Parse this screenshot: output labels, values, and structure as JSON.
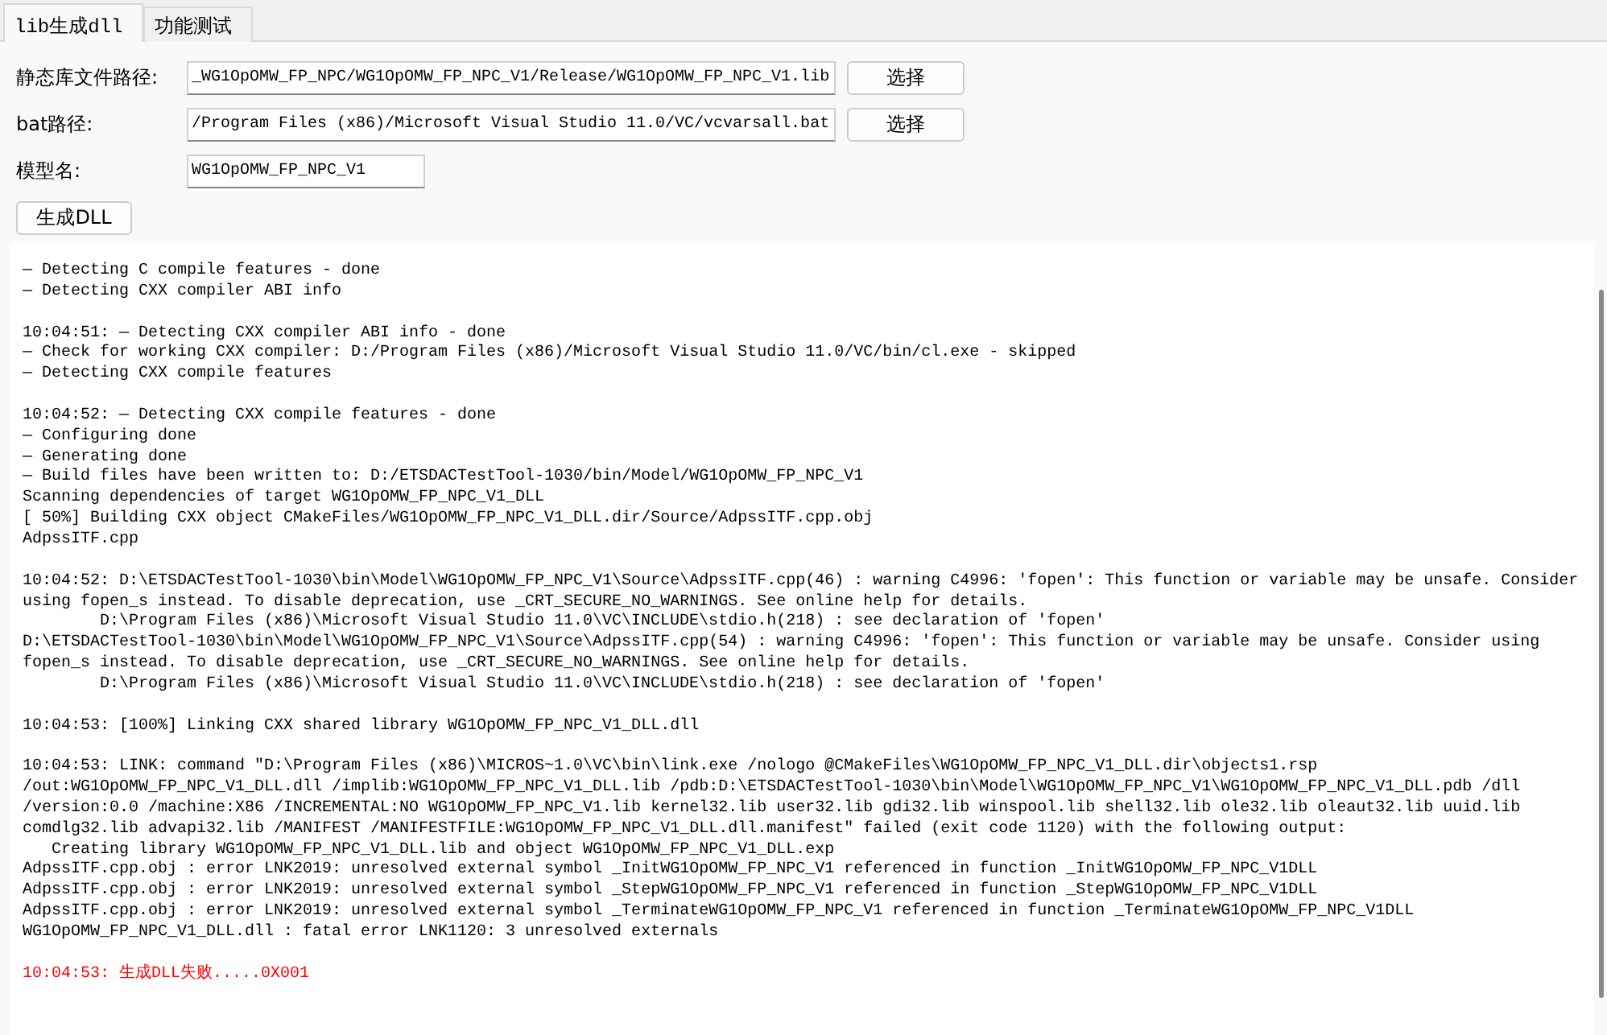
{
  "tabs": [
    {
      "label": "lib生成dll",
      "selected": true
    },
    {
      "label": "功能测试",
      "selected": false
    }
  ],
  "form": [
    {
      "label": "静态库文件路径:",
      "value": "_WG1OpOMW_FP_NPC/WG1OpOMW_FP_NPC_V1/Release/WG1OpOMW_FP_NPC_V1.lib",
      "button": "选择"
    },
    {
      "label": "bat路径:",
      "value": "/Program Files (x86)/Microsoft Visual Studio 11.0/VC/vcvarsall.bat",
      "button": "选择"
    },
    {
      "label": "模型名:",
      "value": "WG1OpOMW_FP_NPC_V1"
    }
  ],
  "generate_button": "生成DLL",
  "log": [
    {
      "kind": "plain",
      "text": "— Detecting C compile features - done"
    },
    {
      "kind": "plain",
      "text": "— Detecting CXX compiler ABI info"
    },
    {
      "kind": "blank"
    },
    {
      "kind": "plain",
      "text": "10:04:51: — Detecting CXX compiler ABI info - done"
    },
    {
      "kind": "plain",
      "text": "— Check for working CXX compiler: D:/Program Files (x86)/Microsoft Visual Studio 11.0/VC/bin/cl.exe - skipped"
    },
    {
      "kind": "plain",
      "text": "— Detecting CXX compile features"
    },
    {
      "kind": "blank"
    },
    {
      "kind": "plain",
      "text": "10:04:52: — Detecting CXX compile features - done"
    },
    {
      "kind": "plain",
      "text": "— Configuring done"
    },
    {
      "kind": "plain",
      "text": "— Generating done"
    },
    {
      "kind": "plain",
      "text": "— Build files have been written to: D:/ETSDACTestTool-1030/bin/Model/WG1OpOMW_FP_NPC_V1"
    },
    {
      "kind": "plain",
      "text": "Scanning dependencies of target WG1OpOMW_FP_NPC_V1_DLL"
    },
    {
      "kind": "plain",
      "text": "[ 50%] Building CXX object CMakeFiles/WG1OpOMW_FP_NPC_V1_DLL.dir/Source/AdpssITF.cpp.obj"
    },
    {
      "kind": "plain",
      "text": "AdpssITF.cpp"
    },
    {
      "kind": "blank"
    },
    {
      "kind": "plain",
      "text": "10:04:52: D:\\ETSDACTestTool-1030\\bin\\Model\\WG1OpOMW_FP_NPC_V1\\Source\\AdpssITF.cpp(46) : warning C4996: 'fopen': This function or variable may be unsafe. Consider"
    },
    {
      "kind": "plain",
      "text": "using fopen_s instead. To disable deprecation, use _CRT_SECURE_NO_WARNINGS. See online help for details."
    },
    {
      "kind": "tab",
      "text": "D:\\Program Files (x86)\\Microsoft Visual Studio 11.0\\VC\\INCLUDE\\stdio.h(218) : see declaration of 'fopen'"
    },
    {
      "kind": "plain",
      "text": "D:\\ETSDACTestTool-1030\\bin\\Model\\WG1OpOMW_FP_NPC_V1\\Source\\AdpssITF.cpp(54) : warning C4996: 'fopen': This function or variable may be unsafe. Consider using"
    },
    {
      "kind": "plain",
      "text": "fopen_s instead. To disable deprecation, use _CRT_SECURE_NO_WARNINGS. See online help for details."
    },
    {
      "kind": "tab",
      "text": "D:\\Program Files (x86)\\Microsoft Visual Studio 11.0\\VC\\INCLUDE\\stdio.h(218) : see declaration of 'fopen'"
    },
    {
      "kind": "blank"
    },
    {
      "kind": "plain",
      "text": "10:04:53: [100%] Linking CXX shared library WG1OpOMW_FP_NPC_V1_DLL.dll"
    },
    {
      "kind": "blank"
    },
    {
      "kind": "plain",
      "text": "10:04:53: LINK: command \"D:\\Program Files (x86)\\MICROS~1.0\\VC\\bin\\link.exe /nologo @CMakeFiles\\WG1OpOMW_FP_NPC_V1_DLL.dir\\objects1.rsp"
    },
    {
      "kind": "plain",
      "text": "/out:WG1OpOMW_FP_NPC_V1_DLL.dll /implib:WG1OpOMW_FP_NPC_V1_DLL.lib /pdb:D:\\ETSDACTestTool-1030\\bin\\Model\\WG1OpOMW_FP_NPC_V1\\WG1OpOMW_FP_NPC_V1_DLL.pdb /dll"
    },
    {
      "kind": "plain",
      "text": "/version:0.0 /machine:X86 /INCREMENTAL:NO WG1OpOMW_FP_NPC_V1.lib kernel32.lib user32.lib gdi32.lib winspool.lib shell32.lib ole32.lib oleaut32.lib uuid.lib"
    },
    {
      "kind": "plain",
      "text": "comdlg32.lib advapi32.lib /MANIFEST /MANIFESTFILE:WG1OpOMW_FP_NPC_V1_DLL.dll.manifest\" failed (exit code 1120) with the following output:"
    },
    {
      "kind": "space",
      "text": "Creating library WG1OpOMW_FP_NPC_V1_DLL.lib and object WG1OpOMW_FP_NPC_V1_DLL.exp"
    },
    {
      "kind": "plain",
      "text": "AdpssITF.cpp.obj : error LNK2019: unresolved external symbol _InitWG1OpOMW_FP_NPC_V1 referenced in function _InitWG1OpOMW_FP_NPC_V1DLL"
    },
    {
      "kind": "plain",
      "text": "AdpssITF.cpp.obj : error LNK2019: unresolved external symbol _StepWG1OpOMW_FP_NPC_V1 referenced in function _StepWG1OpOMW_FP_NPC_V1DLL"
    },
    {
      "kind": "plain",
      "text": "AdpssITF.cpp.obj : error LNK2019: unresolved external symbol _TerminateWG1OpOMW_FP_NPC_V1 referenced in function _TerminateWG1OpOMW_FP_NPC_V1DLL"
    },
    {
      "kind": "plain",
      "text": "WG1OpOMW_FP_NPC_V1_DLL.dll : fatal error LNK1120: 3 unresolved externals"
    },
    {
      "kind": "blank"
    },
    {
      "kind": "error",
      "text": "10:04:53: 生成DLL失败.....0X001"
    }
  ]
}
